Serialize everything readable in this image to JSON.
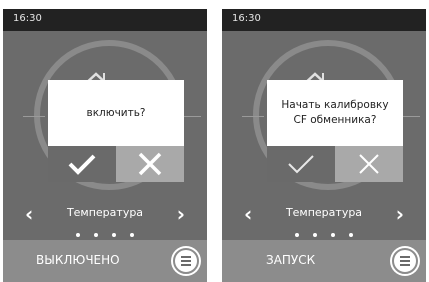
{
  "colors": {
    "screen_bg": "#6b6b6b",
    "status_bg": "#222222",
    "bottom_bg": "#8c8c8c",
    "ok_button": "#6a6a6a",
    "cancel_button": "#a9a9a9"
  },
  "screens": [
    {
      "status": {
        "time": "16:30"
      },
      "dialog": {
        "message": "включить?",
        "ok_icon": "check-icon",
        "cancel_icon": "close-icon"
      },
      "nav": {
        "title": "Температура",
        "prev_label": "‹",
        "next_label": "›",
        "page_count": 4,
        "active_page": 1
      },
      "bottom": {
        "label": "ВЫКЛЮЧЕНО",
        "menu_icon": "menu-icon"
      }
    },
    {
      "status": {
        "time": "16:30"
      },
      "dialog": {
        "message": "Начать калибровку CF обменника?",
        "ok_icon": "check-icon",
        "cancel_icon": "close-icon"
      },
      "nav": {
        "title": "Температура",
        "prev_label": "‹",
        "next_label": "›",
        "page_count": 4,
        "active_page": 1
      },
      "bottom": {
        "label": "ЗАПУСК",
        "menu_icon": "menu-icon"
      }
    }
  ]
}
